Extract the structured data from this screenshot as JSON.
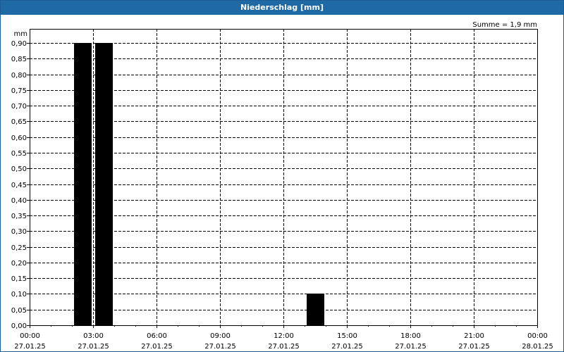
{
  "title": "Niederschlag [mm]",
  "summary": "Summe = 1,9 mm",
  "colors": {
    "title_bar": "#1f6aa5",
    "bars": "#000000",
    "grid": "#000000",
    "background": "#ffffff"
  },
  "chart_data": {
    "type": "bar",
    "title": "Niederschlag [mm]",
    "ylabel": "mm",
    "xlabel": "",
    "ylim": [
      0,
      0.9
    ],
    "yticks": [
      "0,00",
      "0,05",
      "0,10",
      "0,15",
      "0,20",
      "0,25",
      "0,30",
      "0,35",
      "0,40",
      "0,45",
      "0,50",
      "0,55",
      "0,60",
      "0,65",
      "0,70",
      "0,75",
      "0,80",
      "0,85",
      "0,90"
    ],
    "xlim": [
      "27.01.25 00:00",
      "28.01.25 00:00"
    ],
    "xticks": [
      {
        "time": "00:00",
        "date": "27.01.25"
      },
      {
        "time": "03:00",
        "date": "27.01.25"
      },
      {
        "time": "06:00",
        "date": "27.01.25"
      },
      {
        "time": "09:00",
        "date": "27.01.25"
      },
      {
        "time": "12:00",
        "date": "27.01.25"
      },
      {
        "time": "15:00",
        "date": "27.01.25"
      },
      {
        "time": "18:00",
        "date": "27.01.25"
      },
      {
        "time": "21:00",
        "date": "27.01.25"
      },
      {
        "time": "00:00",
        "date": "28.01.25"
      }
    ],
    "bars": [
      {
        "start": "27.01.25 02:00",
        "end": "27.01.25 03:00",
        "value": 0.9
      },
      {
        "start": "27.01.25 03:00",
        "end": "27.01.25 04:00",
        "value": 0.9
      },
      {
        "start": "27.01.25 13:00",
        "end": "27.01.25 14:00",
        "value": 0.1
      }
    ],
    "grid": true
  }
}
